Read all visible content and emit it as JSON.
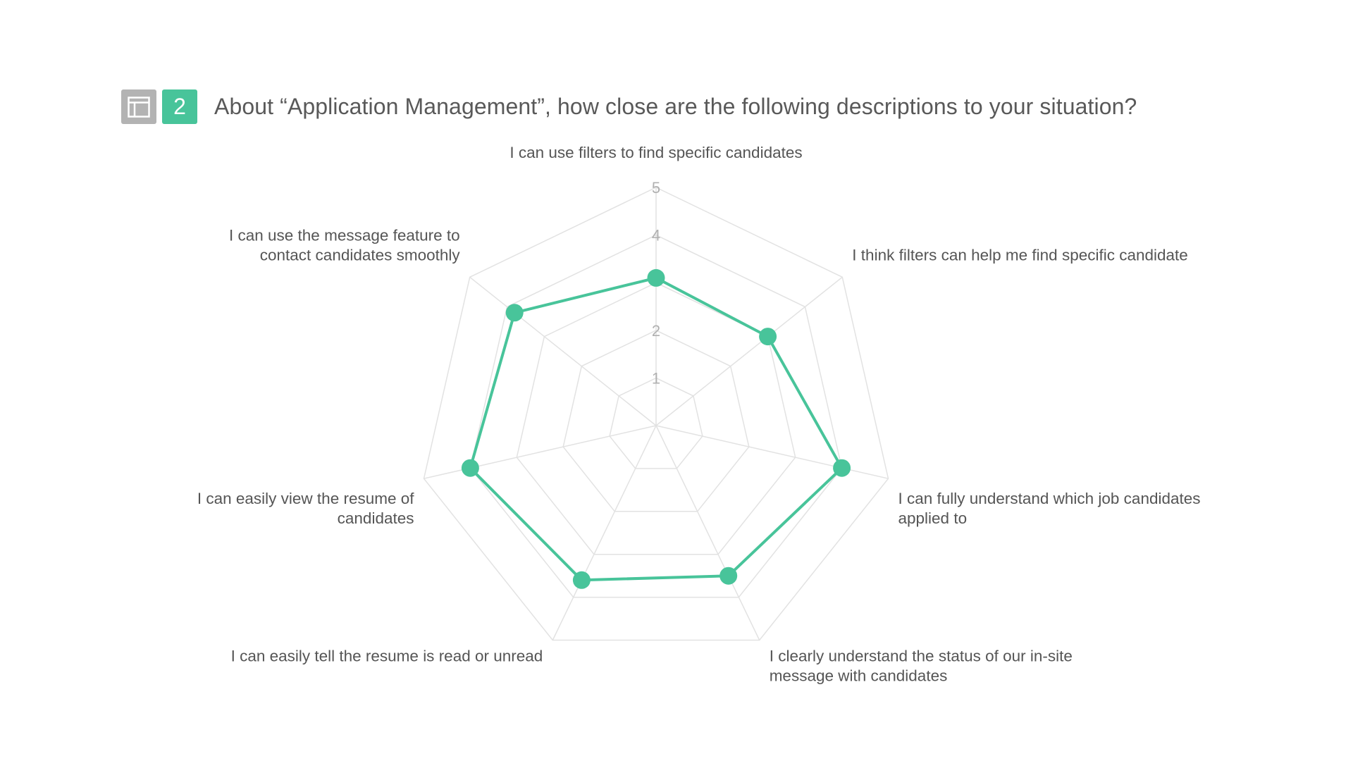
{
  "question": {
    "number": "2",
    "title": "About “Application Management”, how close are the following descriptions to your situation?",
    "view_icon": "layout-panel-icon"
  },
  "colors": {
    "accent": "#48c49a",
    "grid": "#e2e2e2",
    "tick": "#b0b0b0",
    "text": "#555555",
    "icon_bg": "#b3b3b3"
  },
  "chart_data": {
    "type": "radar",
    "axes": [
      "I can use filters to find specific candidates",
      "I think filters can help me find specific candidate",
      "I can fully understand which job candidates applied to",
      "I clearly understand the status of our in-site message with candidates",
      "I can easily tell the resume is read or unread",
      "I can easily view the resume of candidates",
      "I can use the message feature to contact candidates smoothly"
    ],
    "axis_label_lines": [
      [
        "I can use filters to find specific candidates"
      ],
      [
        "I think filters can help me find specific candidate"
      ],
      [
        "I can fully understand which job candidates",
        "applied to"
      ],
      [
        "I clearly understand the status of our in-site",
        "message with candidates"
      ],
      [
        "I can easily tell the resume is read or unread"
      ],
      [
        "I can easily view the resume of",
        "candidates"
      ],
      [
        "I can use the message feature to",
        "contact candidates smoothly"
      ]
    ],
    "values": [
      3.1,
      3.0,
      4.0,
      3.5,
      3.6,
      4.0,
      3.8
    ],
    "rmin": 0,
    "rmax": 5,
    "ticks": [
      1,
      2,
      4,
      5
    ],
    "grid_levels": [
      1,
      2,
      3,
      4,
      5
    ],
    "grid": true,
    "legend": "none"
  }
}
